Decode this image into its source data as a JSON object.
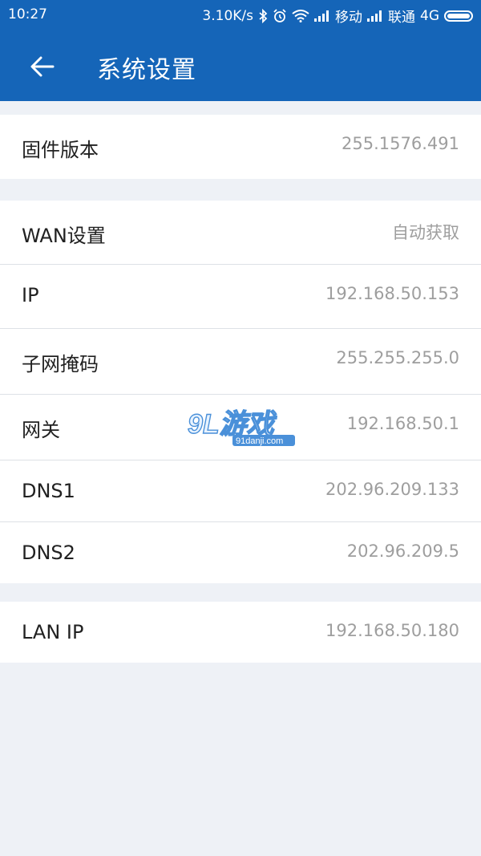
{
  "status_bar": {
    "time": "10:27",
    "speed": "3.10K/s",
    "carrier1": "移动",
    "carrier2": "联通",
    "network": "4G"
  },
  "app_bar": {
    "title": "系统设置",
    "back_icon": "arrow-left-icon"
  },
  "sections": {
    "firmware": {
      "label": "固件版本",
      "value": "255.1576.491"
    },
    "wan": {
      "header_label": "WAN设置",
      "header_value": "自动获取",
      "ip_label": "IP",
      "ip_value": "192.168.50.153",
      "mask_label": "子网掩码",
      "mask_value": "255.255.255.0",
      "gateway_label": "网关",
      "gateway_value": "192.168.50.1",
      "dns1_label": "DNS1",
      "dns1_value": "202.96.209.133",
      "dns2_label": "DNS2",
      "dns2_value": "202.96.209.5"
    },
    "lan": {
      "label": "LAN IP",
      "value": "192.168.50.180"
    }
  },
  "watermark": {
    "brand": "9L游戏",
    "domain": "91danji.com"
  },
  "colors": {
    "primary": "#1565b8",
    "background": "#eef1f6",
    "value_text": "#9e9e9e"
  }
}
